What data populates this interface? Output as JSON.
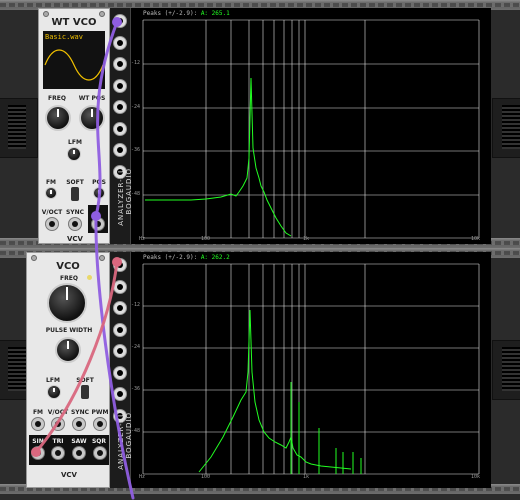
{
  "wt_vco": {
    "title": "WT VCO",
    "wave_file": "Basic.wav",
    "freq_label": "FREQ",
    "wtpos_label": "WT POS",
    "lfm_label": "LFM",
    "fm_label": "FM",
    "soft_label": "SOFT",
    "pos_label": "POS",
    "voct_label": "V/OCT",
    "sync_label": "SYNC",
    "out_label": "W",
    "brand": "VCV"
  },
  "vco": {
    "title": "VCO",
    "freq_label": "FREQ",
    "pw_label": "PULSE WIDTH",
    "lfm_label": "LFM",
    "soft_label": "SOFT",
    "fm_label": "FM",
    "voct_label": "V/OCT",
    "sync_label": "SYNC",
    "pwm_label": "PWM",
    "sin_label": "SIN",
    "tri_label": "TRI",
    "saw_label": "SAW",
    "sqr_label": "SQR",
    "brand": "VCV"
  },
  "analyzer_top": {
    "vertical_label": "ANALYZER-XL",
    "brand": "BOGAUDIO",
    "peaks_prefix": "Peaks (+/-2.9):",
    "peaks_channel": "A:",
    "peaks_value": "265.1",
    "x_ticks": [
      "Hz",
      "100",
      "1k",
      "10k"
    ],
    "y_ticks": [
      "-12",
      "-24",
      "-36",
      "-48"
    ]
  },
  "analyzer_bottom": {
    "vertical_label": "ANALYZER-XL",
    "brand": "BOGAUDIO",
    "peaks_prefix": "Peaks (+/-2.9):",
    "peaks_channel": "A:",
    "peaks_value": "262.2",
    "x_ticks": [
      "Hz",
      "100",
      "1k",
      "10k"
    ],
    "y_ticks": [
      "-12",
      "-24",
      "-36",
      "-48"
    ]
  },
  "colors": {
    "spectrum": "#22ff22",
    "cable_purple": "#8f5ee0",
    "cable_pink": "#d9677e",
    "panel": "#e8e8e8",
    "screen": "#000000"
  }
}
